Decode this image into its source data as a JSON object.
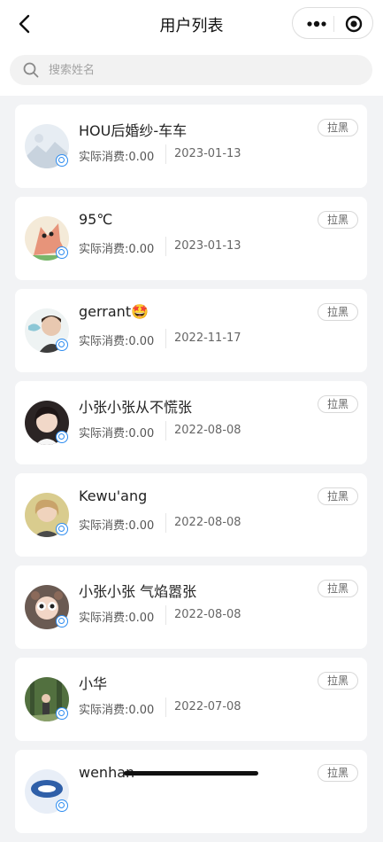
{
  "nav": {
    "title": "用户列表",
    "back_icon": "chevron-left-icon",
    "more_icon": "more-dots-icon",
    "close_icon": "target-circle-icon"
  },
  "search": {
    "placeholder": "搜索姓名",
    "value": ""
  },
  "users": [
    {
      "name": "HOU后婚纱-车车",
      "spend": "实际消费:0.00",
      "date": "2023-01-13",
      "action": "拉黑",
      "avatar_color": "#dfe7ef"
    },
    {
      "name": "95℃",
      "spend": "实际消费:0.00",
      "date": "2023-01-13",
      "action": "拉黑",
      "avatar_color": "#e89a7a"
    },
    {
      "name": "gerrant🤩",
      "spend": "实际消费:0.00",
      "date": "2022-11-17",
      "action": "拉黑",
      "avatar_color": "#d9e6ea"
    },
    {
      "name": "小张小张从不慌张",
      "spend": "实际消费:0.00",
      "date": "2022-08-08",
      "action": "拉黑",
      "avatar_color": "#3a3030"
    },
    {
      "name": "Kewu'ang",
      "spend": "实际消费:0.00",
      "date": "2022-08-08",
      "action": "拉黑",
      "avatar_color": "#d8c487"
    },
    {
      "name": "小张小张 气焰嚣张",
      "spend": "实际消费:0.00",
      "date": "2022-08-08",
      "action": "拉黑",
      "avatar_color": "#6b5a52"
    },
    {
      "name": "小华",
      "spend": "实际消费:0.00",
      "date": "2022-07-08",
      "action": "拉黑",
      "avatar_color": "#4f6b3e"
    },
    {
      "name": "wenhan",
      "spend": "",
      "date": "",
      "action": "拉黑",
      "avatar_color": "#2f5fa8"
    }
  ]
}
